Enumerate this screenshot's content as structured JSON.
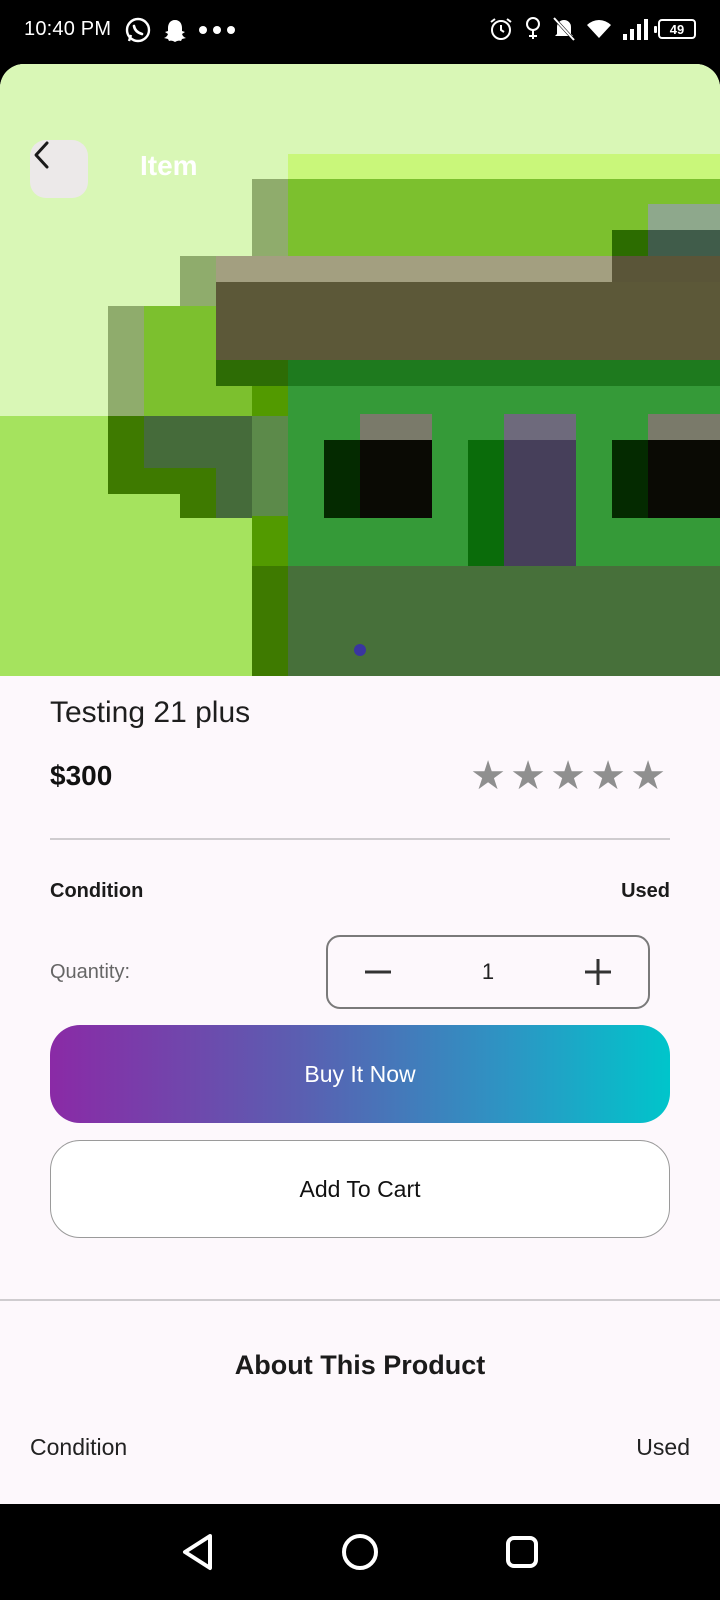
{
  "status_bar": {
    "time": "10:40 PM",
    "battery": "49",
    "left_icons": [
      "whatsapp-icon",
      "snapchat-icon",
      "more-dots-icon"
    ],
    "right_icons": [
      "alarm-icon",
      "location-icon",
      "mute-bell-icon",
      "wifi-icon",
      "signal-icon",
      "battery-icon"
    ]
  },
  "header": {
    "title": "Item"
  },
  "carousel": {
    "current_page": 1
  },
  "product": {
    "name": "Testing 21 plus",
    "price": "$300",
    "rating": 0,
    "rating_max": 5
  },
  "details": {
    "condition_label": "Condition",
    "condition_value": "Used",
    "quantity_label": "Quantity:",
    "quantity_value": "1"
  },
  "actions": {
    "buy_label": "Buy It Now",
    "cart_label": "Add To Cart"
  },
  "about": {
    "title": "About This Product",
    "condition_label": "Condition",
    "condition_value": "Used"
  },
  "nav": {
    "buttons": [
      "back-triangle-icon",
      "home-circle-icon",
      "recents-square-icon"
    ]
  },
  "colors": {
    "gradient_start": "#8a2aa6",
    "gradient_end": "#00c5cb",
    "star": "#8f8f8f",
    "page_background": "#fdf8fc"
  }
}
